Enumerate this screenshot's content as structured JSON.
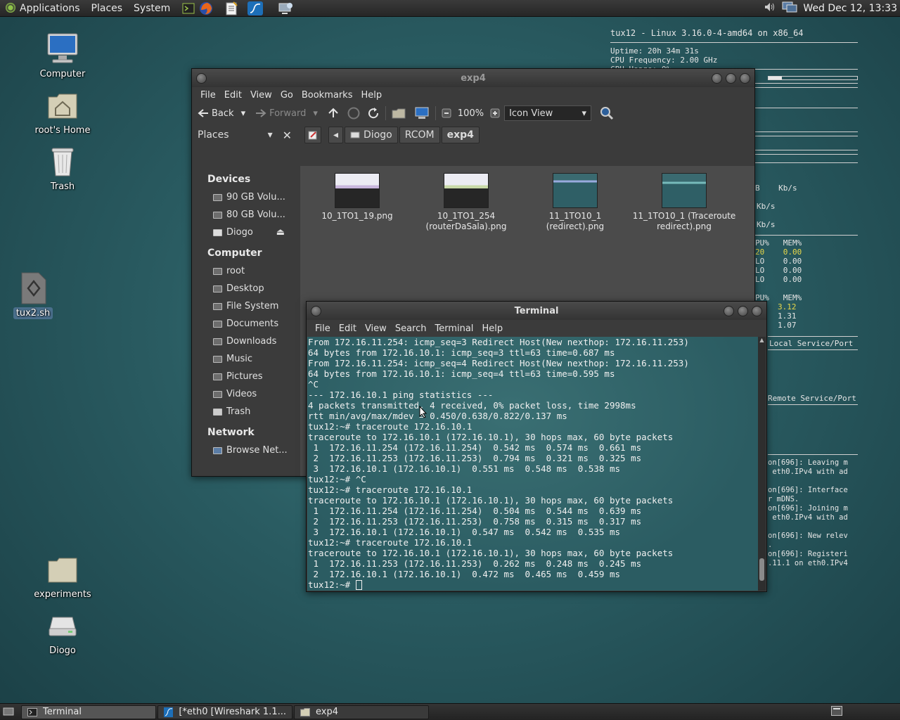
{
  "top_panel": {
    "menus": [
      "Applications",
      "Places",
      "System"
    ],
    "launchers": [
      "terminal-launcher",
      "firefox-launcher",
      "text-editor-launcher",
      "wireshark-launcher",
      "network-launcher"
    ],
    "clock": "Wed Dec 12, 13:33"
  },
  "desktop": {
    "icons": [
      {
        "label": "Computer"
      },
      {
        "label": "root's Home"
      },
      {
        "label": "Trash"
      },
      {
        "label": "tux2.sh"
      },
      {
        "label": "experiments"
      },
      {
        "label": "Diogo"
      }
    ]
  },
  "conky": {
    "header": "tux12 - Linux 3.16.0-4-amd64 on x86_64",
    "uptime": "Uptime: 20h 34m 31s",
    "cpu_freq": "CPU Frequency: 2.00 GHz",
    "cpu_usage": "CPU Usage: 0%",
    "net_header": "B    Kb/s",
    "net_1": "Kb/s",
    "net_2": "Kb/s",
    "cpu_col": "PU%   MEM%",
    "cpu_rows": [
      {
        "cpu": "20",
        "mem": "0.00"
      },
      {
        "cpu": "LO",
        "mem": "0.00"
      },
      {
        "cpu": "LO",
        "mem": "0.00"
      },
      {
        "cpu": "LO",
        "mem": "0.00"
      }
    ],
    "mem_col": "PU%   MEM%",
    "mem_rows": [
      "3.12",
      "1.31",
      "1.07"
    ],
    "local_port": "Local Service/Port",
    "remote_port": "Remote Service/Port",
    "log": [
      "on[696]: Leaving m",
      " eth0.IPv4 with ad",
      "on[696]: Interface",
      "r mDNS.",
      "on[696]: Joining m",
      " eth0.IPv4 with ad",
      "on[696]: New relev",
      ".",
      "on[696]: Registeri",
      ".11.1 on eth0.IPv4"
    ]
  },
  "file_manager": {
    "title": "exp4",
    "menu": [
      "File",
      "Edit",
      "View",
      "Go",
      "Bookmarks",
      "Help"
    ],
    "toolbar": {
      "back": "Back",
      "forward": "Forward",
      "zoom": "100%",
      "view_mode": "Icon View"
    },
    "places_label": "Places",
    "breadcrumbs": [
      "Diogo",
      "RCOM",
      "exp4"
    ],
    "sidebar": {
      "devices_header": "Devices",
      "devices": [
        "90 GB Volu...",
        "80 GB Volu...",
        "Diogo"
      ],
      "computer_header": "Computer",
      "computer": [
        "root",
        "Desktop",
        "File System",
        "Documents",
        "Downloads",
        "Music",
        "Pictures",
        "Videos",
        "Trash"
      ],
      "network_header": "Network",
      "network": [
        "Browse Net..."
      ]
    },
    "files": [
      {
        "name": "10_1TO1_19.png"
      },
      {
        "name": "10_1TO1_254 (routerDaSala).png"
      },
      {
        "name": "11_1TO10_1 (redirect).png"
      },
      {
        "name": "11_1TO10_1 (Traceroute redirect).png"
      }
    ]
  },
  "terminal": {
    "title": "Terminal",
    "menu": [
      "File",
      "Edit",
      "View",
      "Search",
      "Terminal",
      "Help"
    ],
    "lines": [
      "From 172.16.11.254: icmp_seq=3 Redirect Host(New nexthop: 172.16.11.253)",
      "64 bytes from 172.16.10.1: icmp_seq=3 ttl=63 time=0.687 ms",
      "From 172.16.11.254: icmp_seq=4 Redirect Host(New nexthop: 172.16.11.253)",
      "64 bytes from 172.16.10.1: icmp_seq=4 ttl=63 time=0.595 ms",
      "^C",
      "--- 172.16.10.1 ping statistics ---",
      "4 packets transmitted, 4 received, 0% packet loss, time 2998ms",
      "rtt min/avg/max/mdev = 0.450/0.638/0.822/0.137 ms",
      "tux12:~# traceroute 172.16.10.1",
      "traceroute to 172.16.10.1 (172.16.10.1), 30 hops max, 60 byte packets",
      " 1  172.16.11.254 (172.16.11.254)  0.542 ms  0.574 ms  0.661 ms",
      " 2  172.16.11.253 (172.16.11.253)  0.794 ms  0.321 ms  0.325 ms",
      " 3  172.16.10.1 (172.16.10.1)  0.551 ms  0.548 ms  0.538 ms",
      "tux12:~# ^C",
      "tux12:~# traceroute 172.16.10.1",
      "traceroute to 172.16.10.1 (172.16.10.1), 30 hops max, 60 byte packets",
      " 1  172.16.11.254 (172.16.11.254)  0.504 ms  0.544 ms  0.639 ms",
      " 2  172.16.11.253 (172.16.11.253)  0.758 ms  0.315 ms  0.317 ms",
      " 3  172.16.10.1 (172.16.10.1)  0.547 ms  0.542 ms  0.535 ms",
      "tux12:~# traceroute 172.16.10.1",
      "traceroute to 172.16.10.1 (172.16.10.1), 30 hops max, 60 byte packets",
      " 1  172.16.11.253 (172.16.11.253)  0.262 ms  0.248 ms  0.245 ms",
      " 2  172.16.10.1 (172.16.10.1)  0.472 ms  0.465 ms  0.459 ms"
    ],
    "prompt": "tux12:~# "
  },
  "taskbar": {
    "tasks": [
      {
        "label": "Terminal"
      },
      {
        "label": "[*eth0   [Wireshark 1.1..."
      },
      {
        "label": "exp4"
      }
    ]
  }
}
